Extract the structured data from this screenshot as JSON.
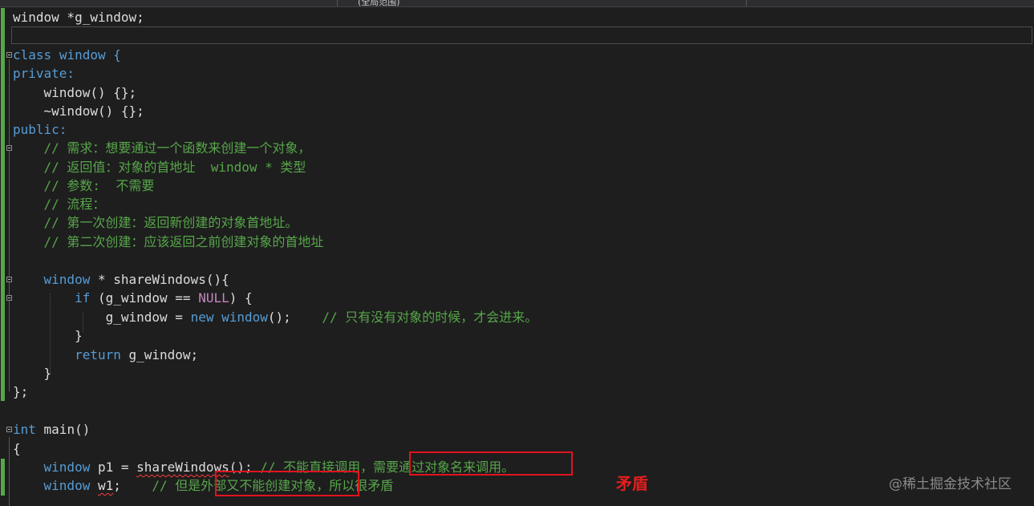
{
  "navbar": {
    "member_dropdown": "(全局范围)"
  },
  "code": {
    "line_global": "window *g_window;",
    "line_class": "window {",
    "kw_class": "class",
    "line_private": "private:",
    "line_ctor": "window() {};",
    "line_dtor": "~window() {};",
    "line_public": "public:",
    "comment_1": "// 需求：想要通过一个函数来创建一个对象，",
    "comment_2": "// 返回值：对象的首地址  window * 类型",
    "comment_3": "// 参数:  不需要",
    "comment_4": "// 流程：",
    "comment_5": "// 第一次创建：返回新创建的对象首地址。",
    "comment_6": "// 第二次创建：应该返回之前创建对象的首地址",
    "share_decl_type": "window",
    "share_decl_rest": " * shareWindows(){",
    "if_kw": "if",
    "if_open": " (g_window == ",
    "if_null": "NULL",
    "if_close": ") {",
    "assign_lhs": "g_window = ",
    "assign_new": "new",
    "assign_space": " ",
    "assign_type": "window",
    "assign_rest": "();    ",
    "assign_comment": "// 只有没有对象的时候，才会进来。",
    "close_if": "}",
    "return_kw": "return",
    "return_rest": " g_window;",
    "close_func": "}",
    "close_class": "};",
    "main_kw": "int",
    "main_rest": " main()",
    "main_open": "{",
    "p1_type": "window",
    "p1_rest_a": " p1 = ",
    "p1_call": "shareWindows",
    "p1_rest_b": "(); ",
    "p1_comment": "// 不能直接调用，需要通过对象名来调用。",
    "w1_type": "window",
    "w1_space": " ",
    "w1_var": "w1",
    "w1_rest": ";    ",
    "w1_comment": "// 但是外部又不能创建对象，所以很矛盾"
  },
  "annotation": {
    "label": "矛盾",
    "color": "#e81d1d"
  },
  "watermark": "@稀土掘金技术社区",
  "colors": {
    "background": "#1e1e1e",
    "keyword": "#569cd6",
    "comment": "#57a64a",
    "macro": "#c586c0",
    "text": "#dcdcdc"
  }
}
